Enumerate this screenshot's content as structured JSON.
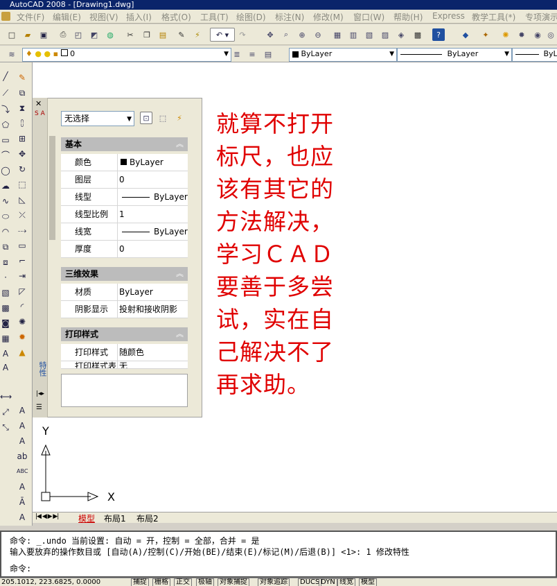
{
  "window": {
    "title": "AutoCAD 2008 - [Drawing1.dwg]"
  },
  "menu": [
    "文件(F)",
    "编辑(E)",
    "视图(V)",
    "插入(I)",
    "格式(O)",
    "工具(T)",
    "绘图(D)",
    "标注(N)",
    "修改(M)",
    "窗口(W)",
    "帮助(H)",
    "Express",
    "教学工具(*)",
    "专项演示"
  ],
  "layers": {
    "current_layer": "0",
    "color": "ByLayer",
    "linetype": "ByLayer",
    "lineweight": "ByLay"
  },
  "properties": {
    "selection": "无选择",
    "strip_label": "特性",
    "sections": [
      {
        "title": "基本",
        "rows": [
          {
            "label": "颜色",
            "value": "ByLayer"
          },
          {
            "label": "图层",
            "value": "0"
          },
          {
            "label": "线型",
            "value": "ByLayer"
          },
          {
            "label": "线型比例",
            "value": "1"
          },
          {
            "label": "线宽",
            "value": "ByLayer"
          },
          {
            "label": "厚度",
            "value": "0"
          }
        ]
      },
      {
        "title": "三维效果",
        "rows": [
          {
            "label": "材质",
            "value": "ByLayer"
          },
          {
            "label": "阴影显示",
            "value": "投射和接收阴影"
          }
        ]
      },
      {
        "title": "打印样式",
        "rows": [
          {
            "label": "打印样式",
            "value": "随颜色"
          },
          {
            "label": "打印样式表",
            "value": "无"
          }
        ]
      }
    ]
  },
  "annotation": [
    "就算不打开",
    "标尺，也应",
    "该有其它的",
    "方法解决，",
    "学习ＣＡＤ",
    "要善于多尝",
    "试，实在自",
    "己解决不了",
    "再求助。"
  ],
  "ucs": {
    "x": "X",
    "y": "Y"
  },
  "tabs": [
    "模型",
    "布局1",
    "布局2"
  ],
  "command": {
    "line1": "命令:  _.undo 当前设置: 自动 = 开，控制 = 全部，合并 = 是",
    "line2": "输入要放弃的操作数目或 [自动(A)/控制(C)/开始(BE)/结束(E)/标记(M)/后退(B)] <1>: 1 修改特性",
    "prompt": "命令:"
  },
  "status": {
    "coords": "205.1012, 223.6825, 0.0000",
    "buttons": [
      "捕捉",
      "栅格",
      "正交",
      "极轴",
      "对象捕捉",
      "对象追踪",
      "DUCS",
      "DYN",
      "线宽",
      "模型"
    ]
  },
  "colors": {
    "annotation": "#e00000",
    "titlebar": "#0a246a",
    "tab_active": "#cc0000"
  }
}
